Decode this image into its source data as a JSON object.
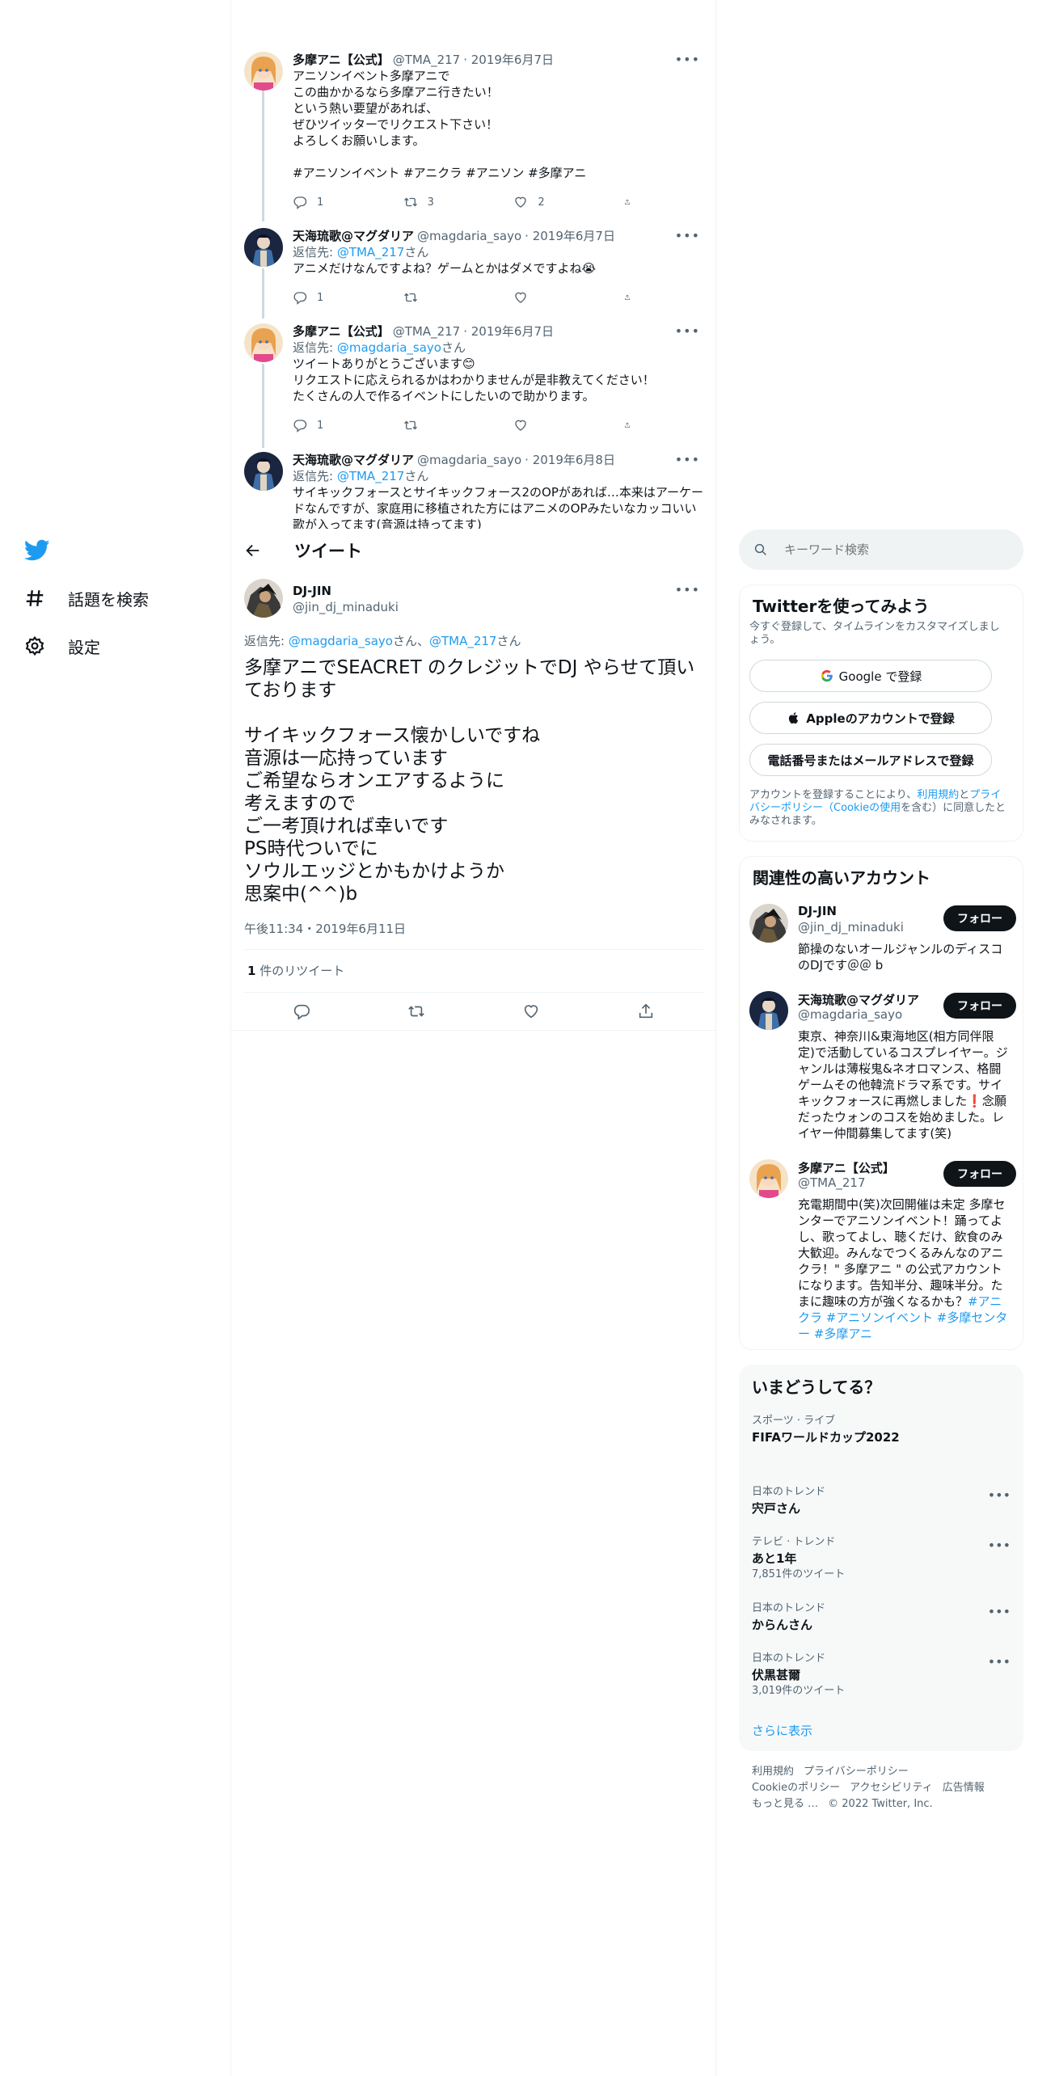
{
  "nav": {
    "explore_label": "話題を検索",
    "settings_label": "設定"
  },
  "thread": [
    {
      "name": "多摩アニ【公式】",
      "handle": "@TMA_217",
      "date": "· 2019年6月7日",
      "text": "アニソンイベント多摩アニで\nこの曲かかるなら多摩アニ行きたい！\nという熱い要望があれば、\nぜひツイッターでリクエスト下さい！\nよろしくお願いします。",
      "hashtags": "#アニソンイベント #アニクラ #アニソン #多摩アニ",
      "replies": "1",
      "retweets": "3",
      "likes": "2"
    },
    {
      "name": "天海琉歌@マグダリア",
      "handle": "@magdaria_sayo",
      "date": "· 2019年6月7日",
      "reply_prefix": "返信先: ",
      "reply_to": "@TMA_217",
      "reply_suffix": "さん",
      "text": "アニメだけなんですよね？ゲームとかはダメですよね😭",
      "replies": "1",
      "retweets": "",
      "likes": ""
    },
    {
      "name": "多摩アニ【公式】",
      "handle": "@TMA_217",
      "date": "· 2019年6月7日",
      "reply_prefix": "返信先: ",
      "reply_to": "@magdaria_sayo",
      "reply_suffix": "さん",
      "text": "ツイートありがとうございます😊\nリクエストに応えられるかはわかりませんが是非教えてください！\nたくさんの人で作るイベントにしたいので助かります。",
      "replies": "1",
      "retweets": "",
      "likes": ""
    },
    {
      "name": "天海琉歌@マグダリア",
      "handle": "@magdaria_sayo",
      "date": "· 2019年6月8日",
      "reply_prefix": "返信先: ",
      "reply_to": "@TMA_217",
      "reply_suffix": "さん",
      "text": "サイキックフォースとサイキックフォース2のOPがあれば…本来はアーケードなんですが、家庭用に移植された方にはアニメのOPみたいなカッコいい歌が入ってます(音源は持ってます)"
    }
  ],
  "header": {
    "title": "ツイート"
  },
  "main_tweet": {
    "name": "DJ-JIN",
    "handle": "@jin_dj_minaduki",
    "reply_prefix": "返信先: ",
    "reply_to_1": "@magdaria_sayo",
    "reply_mid": "さん、",
    "reply_to_2": "@TMA_217",
    "reply_suffix": "さん",
    "text": "多摩アニでSEACRET のクレジットでDJ やらせて頂いております\n\nサイキックフォース懐かしいですね\n音源は一応持っています\nご希望ならオンエアするように\n考えますので\nご一考頂ければ幸いです\nPS時代ついでに\nソウルエッジとかもかけようか\n思案中(^^)b",
    "timestamp": "午後11:34・2019年6月11日",
    "retweet_count": "1",
    "retweet_label": " 件のリツイート"
  },
  "search": {
    "placeholder": "キーワード検索"
  },
  "signup": {
    "title": "Twitterを使ってみよう",
    "subtitle": "今すぐ登録して、タイムラインをカスタマイズしましょう。",
    "google": "Google で登録",
    "apple": "Appleのアカウントで登録",
    "phone": "電話番号またはメールアドレスで登録",
    "legal_1": "アカウントを登録することにより、",
    "legal_terms": "利用規約",
    "legal_2": "と",
    "legal_privacy": "プライバシーポリシー（Cookieの使用",
    "legal_3": "を含む）に同意したとみなされます。"
  },
  "related": {
    "title": "関連性の高いアカウント",
    "follow_label": "フォロー",
    "accounts": [
      {
        "name": "DJ-JIN",
        "handle": "@jin_dj_minaduki",
        "bio": "節操のないオールジャンルのディスコのDJです＠＠ b"
      },
      {
        "name": "天海琉歌@マグダリア",
        "handle": "@magdaria_sayo",
        "bio": "東京、神奈川&東海地区(相方同伴限定)で活動しているコスプレイヤー。ジャンルは薄桜鬼&ネオロマンス、格闘ゲームその他韓流ドラマ系です。サイキックフォースに再燃しました❗念願だったウォンのコスを始めました。レイヤー仲間募集してます(笑)"
      },
      {
        "name": "多摩アニ【公式】",
        "handle": "@TMA_217",
        "bio": "充電期間中(笑)次回開催は未定 多摩センターでアニソンイベント！踊ってよし、歌ってよし、聴くだけ、飲食のみ大歓迎。みんなでつくるみんなのアニクラ！\" 多摩アニ \" の公式アカウントになります。告知半分、趣味半分。たまに趣味の方が強くなるかも？",
        "bio_tags": "#アニクラ #アニソンイベント #多摩センター #多摩アニ"
      }
    ]
  },
  "trends": {
    "title": "いまどうしてる？",
    "items": [
      {
        "context": "スポーツ · ライブ",
        "name": "FIFAワールドカップ2022",
        "count": ""
      },
      {
        "context": "日本のトレンド",
        "name": "宍戸さん",
        "count": ""
      },
      {
        "context": "テレビ · トレンド",
        "name": "あと1年",
        "count": "7,851件のツイート"
      },
      {
        "context": "日本のトレンド",
        "name": "からんさん",
        "count": ""
      },
      {
        "context": "日本のトレンド",
        "name": "伏黒甚爾",
        "count": "3,019件のツイート"
      }
    ],
    "show_more": "さらに表示"
  },
  "footer": {
    "terms": "利用規約",
    "privacy": "プライバシーポリシー",
    "cookie": "Cookieのポリシー",
    "accessibility": "アクセシビリティ",
    "ads": "広告情報",
    "more": "もっと見る …",
    "copyright": "© 2022 Twitter, Inc."
  },
  "colors": {
    "accent": "#1d9bf0",
    "text": "#0f1419",
    "muted": "#536471"
  }
}
